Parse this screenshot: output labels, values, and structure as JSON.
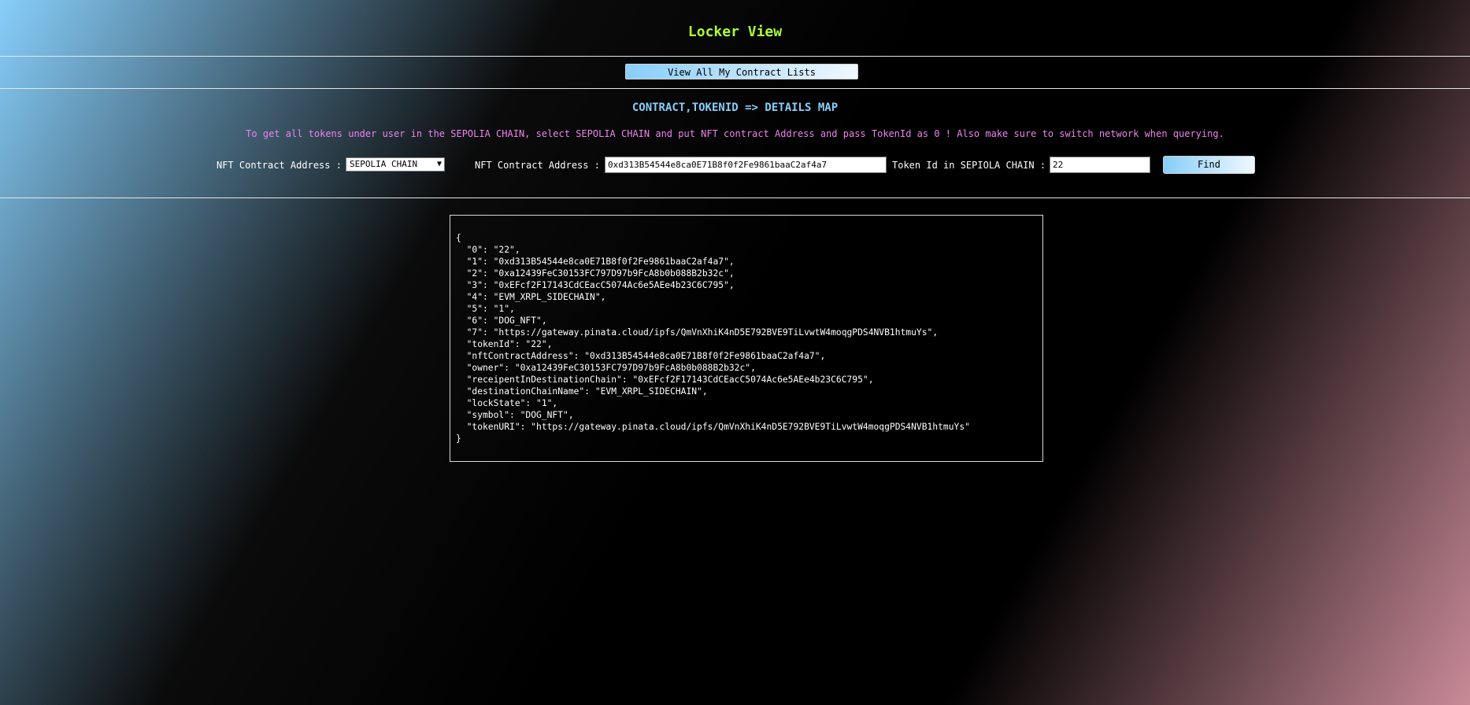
{
  "page": {
    "title": "Locker View"
  },
  "toolbar": {
    "view_all_label": "View All My Contract Lists"
  },
  "section": {
    "title": "CONTRACT,TOKENID => DETAILS MAP",
    "instructions": "To get all tokens under user in the SEPOLIA CHAIN, select SEPOLIA CHAIN and put NFT contract Address and pass TokenId as 0 ! Also make sure to switch network when querying."
  },
  "form": {
    "chain_label": "NFT Contract Address :",
    "chain_selected": "SEPOLIA CHAIN",
    "contract_label": "NFT Contract Address :",
    "contract_value": "0xd313B54544e8ca0E71B8f0f2Fe9861baaC2af4a7",
    "token_label": "Token Id in SEPIOLA CHAIN :",
    "token_value": "22",
    "find_label": "Find"
  },
  "result": {
    "json": "{\n  \"0\": \"22\",\n  \"1\": \"0xd313B54544e8ca0E71B8f0f2Fe9861baaC2af4a7\",\n  \"2\": \"0xa12439FeC30153FC797D97b9FcA8b0b088B2b32c\",\n  \"3\": \"0xEFcf2F17143CdCEacC5074Ac6e5AEe4b23C6C795\",\n  \"4\": \"EVM_XRPL_SIDECHAIN\",\n  \"5\": \"1\",\n  \"6\": \"DOG_NFT\",\n  \"7\": \"https://gateway.pinata.cloud/ipfs/QmVnXhiK4nD5E792BVE9TiLvwtW4moqgPDS4NVB1htmuYs\",\n  \"tokenId\": \"22\",\n  \"nftContractAddress\": \"0xd313B54544e8ca0E71B8f0f2Fe9861baaC2af4a7\",\n  \"owner\": \"0xa12439FeC30153FC797D97b9FcA8b0b088B2b32c\",\n  \"receipentInDestinationChain\": \"0xEFcf2F17143CdCEacC5074Ac6e5AEe4b23C6C795\",\n  \"destinationChainName\": \"EVM_XRPL_SIDECHAIN\",\n  \"lockState\": \"1\",\n  \"symbol\": \"DOG_NFT\",\n  \"tokenURI\": \"https://gateway.pinata.cloud/ipfs/QmVnXhiK4nD5E792BVE9TiLvwtW4moqgPDS4NVB1htmuYs\"\n}"
  },
  "icons": {
    "select_chevron": "chevron-down-icon"
  },
  "colors": {
    "title": "#adff2f",
    "section_title": "#87cefa",
    "instructions": "#ee82ee",
    "button_gradient_start": "#87cefa",
    "button_gradient_end": "#f0f8ff",
    "background": "#000000"
  }
}
